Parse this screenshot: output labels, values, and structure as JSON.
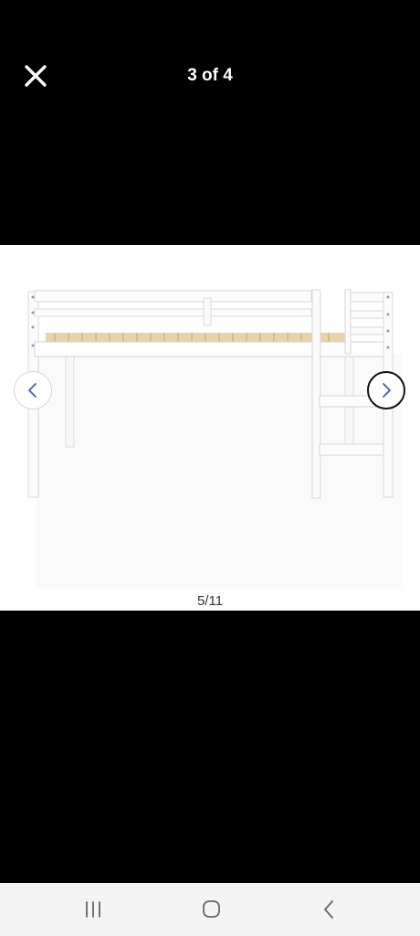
{
  "viewer": {
    "counter": "3 of 4",
    "image_index": "5/11"
  },
  "icons": {
    "close": "close-icon",
    "prev": "chevron-left-icon",
    "next": "chevron-right-icon",
    "recents": "recent-apps-icon",
    "home": "home-icon",
    "back": "back-icon"
  },
  "colors": {
    "background": "#000000",
    "arrow_accent": "#3a62a8",
    "navbar": "#f4f4f4"
  }
}
